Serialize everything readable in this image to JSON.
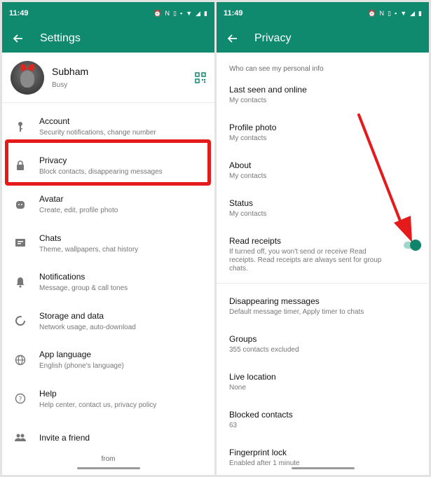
{
  "status_bar": {
    "time": "11:49"
  },
  "left": {
    "title": "Settings",
    "profile": {
      "name": "Subham",
      "status": "Busy"
    },
    "items": [
      {
        "id": "account",
        "title": "Account",
        "subtitle": "Security notifications, change number",
        "icon": "key-icon"
      },
      {
        "id": "privacy",
        "title": "Privacy",
        "subtitle": "Block contacts, disappearing messages",
        "icon": "lock-icon"
      },
      {
        "id": "avatar",
        "title": "Avatar",
        "subtitle": "Create, edit, profile photo",
        "icon": "avatar-icon"
      },
      {
        "id": "chats",
        "title": "Chats",
        "subtitle": "Theme, wallpapers, chat history",
        "icon": "chat-icon"
      },
      {
        "id": "notifications",
        "title": "Notifications",
        "subtitle": "Message, group & call tones",
        "icon": "bell-icon"
      },
      {
        "id": "storage",
        "title": "Storage and data",
        "subtitle": "Network usage, auto-download",
        "icon": "storage-icon"
      },
      {
        "id": "language",
        "title": "App language",
        "subtitle": "English (phone's language)",
        "icon": "globe-icon"
      },
      {
        "id": "help",
        "title": "Help",
        "subtitle": "Help center, contact us, privacy policy",
        "icon": "help-icon"
      },
      {
        "id": "invite",
        "title": "Invite a friend",
        "subtitle": "",
        "icon": "people-icon"
      }
    ],
    "footer": "from"
  },
  "right": {
    "title": "Privacy",
    "section_header": "Who can see my personal info",
    "items": [
      {
        "title": "Last seen and online",
        "subtitle": "My contacts"
      },
      {
        "title": "Profile photo",
        "subtitle": "My contacts"
      },
      {
        "title": "About",
        "subtitle": "My contacts"
      },
      {
        "title": "Status",
        "subtitle": "My contacts"
      }
    ],
    "read_receipts": {
      "title": "Read receipts",
      "subtitle": "If turned off, you won't send or receive Read receipts. Read receipts are always sent for group chats.",
      "enabled": true
    },
    "items2": [
      {
        "title": "Disappearing messages",
        "subtitle": "Default message timer, Apply timer to chats"
      },
      {
        "title": "Groups",
        "subtitle": "355 contacts excluded"
      },
      {
        "title": "Live location",
        "subtitle": "None"
      },
      {
        "title": "Blocked contacts",
        "subtitle": "63"
      },
      {
        "title": "Fingerprint lock",
        "subtitle": "Enabled after 1 minute"
      }
    ]
  },
  "colors": {
    "brand": "#0f8a6f",
    "highlight": "#e51a1a",
    "toggle_on": "#10856b"
  }
}
